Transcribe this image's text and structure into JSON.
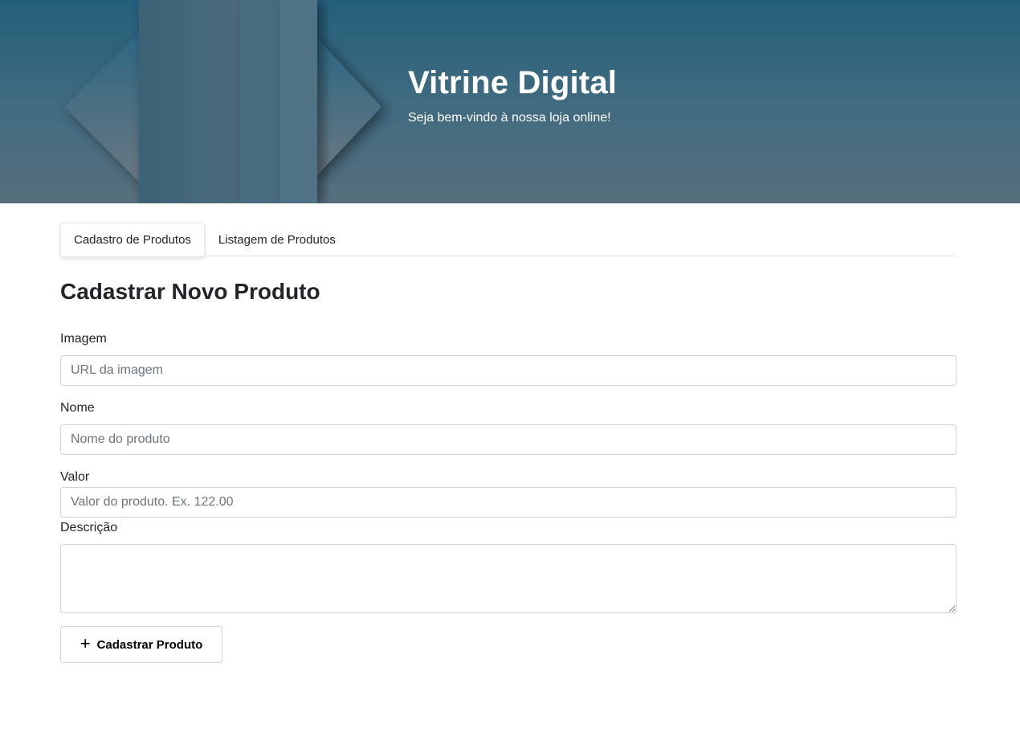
{
  "hero": {
    "title": "Vitrine Digital",
    "subtitle": "Seja bem-vindo à nossa loja online!"
  },
  "tabs": [
    {
      "label": "Cadastro de Produtos",
      "active": true
    },
    {
      "label": "Listagem de Produtos",
      "active": false
    }
  ],
  "form": {
    "title": "Cadastrar Novo Produto",
    "imagem": {
      "label": "Imagem",
      "placeholder": "URL da imagem",
      "value": ""
    },
    "nome": {
      "label": "Nome",
      "placeholder": "Nome do produto",
      "value": ""
    },
    "valor": {
      "label": "Valor",
      "placeholder": "Valor do produto. Ex. 122.00",
      "value": ""
    },
    "descricao": {
      "label": "Descrição",
      "value": ""
    },
    "submit": {
      "icon": "plus-icon",
      "label": "Cadastrar Produto"
    }
  },
  "colors": {
    "hero_top": "#245f7a",
    "hero_bottom": "#576f7d",
    "text": "#212529",
    "border": "#ced4da"
  }
}
